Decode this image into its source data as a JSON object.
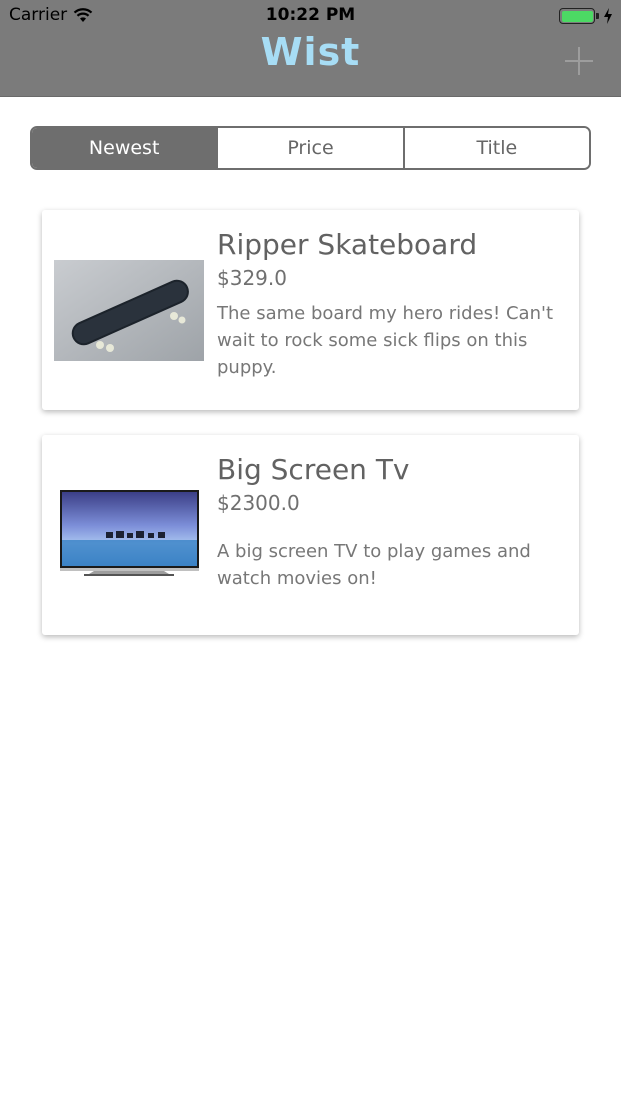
{
  "status_bar": {
    "carrier": "Carrier",
    "time": "10:22 PM",
    "battery_level": 1.0
  },
  "header": {
    "title": "Wist",
    "title_color": "#a7ddf5",
    "add_icon": "plus-icon"
  },
  "sort_control": {
    "segments": [
      "Newest",
      "Price",
      "Title"
    ],
    "selected": "Newest"
  },
  "items": [
    {
      "title": "Ripper Skateboard",
      "price": "$329.0",
      "description": "The same board my hero rides! Can't wait to rock some sick flips on this puppy.",
      "image": "skateboard-photo"
    },
    {
      "title": "Big Screen Tv",
      "price": "$2300.0",
      "description": "A big screen TV to play games and watch movies on!",
      "image": "television-photo"
    }
  ]
}
